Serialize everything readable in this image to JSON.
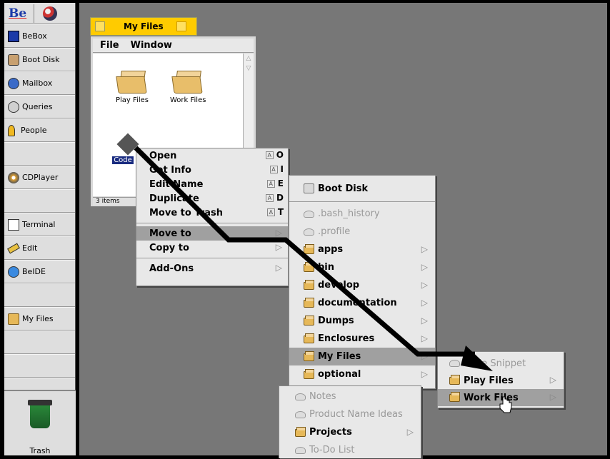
{
  "deskbar": {
    "logo": "Be",
    "items": [
      {
        "label": "BeBox",
        "icon": "bebox-icon"
      },
      {
        "label": "Boot Disk",
        "icon": "disk-icon"
      },
      {
        "label": "Mailbox",
        "icon": "mailbox-icon"
      },
      {
        "label": "Queries",
        "icon": "queries-icon"
      },
      {
        "label": "People",
        "icon": "person-icon"
      },
      {
        "label": "CDPlayer",
        "icon": "cd-icon"
      },
      {
        "label": "Terminal",
        "icon": "terminal-icon"
      },
      {
        "label": "Edit",
        "icon": "edit-icon"
      },
      {
        "label": "BeIDE",
        "icon": "beide-icon"
      },
      {
        "label": "My Files",
        "icon": "folder-icon"
      }
    ],
    "trash_label": "Trash"
  },
  "window": {
    "title": "My Files",
    "menu": [
      "File",
      "Window"
    ],
    "files": [
      {
        "label": "Play Files"
      },
      {
        "label": "Work Files"
      },
      {
        "label": "Code"
      }
    ],
    "status": "3 items"
  },
  "context_menu": {
    "items": [
      {
        "label": "Open",
        "shortcut": "O"
      },
      {
        "label": "Get Info",
        "shortcut": "I"
      },
      {
        "label": "Edit Name",
        "shortcut": "E"
      },
      {
        "label": "Duplicate",
        "shortcut": "D"
      },
      {
        "label": "Move to Trash",
        "shortcut": "T"
      }
    ],
    "move_to": "Move to",
    "copy_to": "Copy to",
    "add_ons": "Add-Ons",
    "shortcut_key_glyph": "A"
  },
  "submenu_boot": {
    "header": "Boot Disk",
    "items": [
      {
        "label": ".bash_history",
        "type": "file",
        "disabled": true
      },
      {
        "label": ".profile",
        "type": "file",
        "disabled": true
      },
      {
        "label": "apps",
        "type": "folder"
      },
      {
        "label": "bin",
        "type": "folder"
      },
      {
        "label": "develop",
        "type": "folder"
      },
      {
        "label": "documentation",
        "type": "folder"
      },
      {
        "label": "Dumps",
        "type": "folder"
      },
      {
        "label": "Enclosures",
        "type": "folder"
      },
      {
        "label": "My Files",
        "type": "folder",
        "highlighted": true
      },
      {
        "label": "optional",
        "type": "folder"
      }
    ]
  },
  "submenu_myfiles": {
    "items": [
      {
        "label": "Code Snippet",
        "disabled": true
      },
      {
        "label": "Play Files"
      },
      {
        "label": "Work Files",
        "highlighted": true
      }
    ]
  },
  "submenu_lower": {
    "items": [
      {
        "label": "Notes",
        "disabled": true
      },
      {
        "label": "Product Name Ideas",
        "disabled": true
      },
      {
        "label": "Projects"
      },
      {
        "label": "To-Do List",
        "disabled": true
      }
    ]
  },
  "colors": {
    "desktop": "#777777",
    "window_tab": "#ffcb00",
    "highlight": "#a0a0a0"
  }
}
